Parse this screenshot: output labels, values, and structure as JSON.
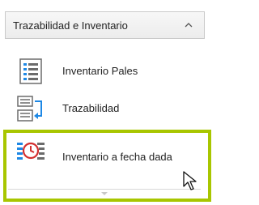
{
  "section": {
    "title": "Trazabilidad e Inventario",
    "toggle_icon": "chevron-up-icon"
  },
  "items": [
    {
      "label": "Inventario Pales",
      "icon": "table-grid-icon"
    },
    {
      "label": "Trazabilidad",
      "icon": "trace-flow-icon"
    },
    {
      "label": "Inventario a fecha dada",
      "icon": "inventory-clock-icon",
      "selected": true
    }
  ],
  "colors": {
    "selection_border": "#a8c600",
    "icon_blue": "#1e88e5",
    "icon_red": "#d32f2f",
    "icon_gray": "#6b6b6b"
  }
}
